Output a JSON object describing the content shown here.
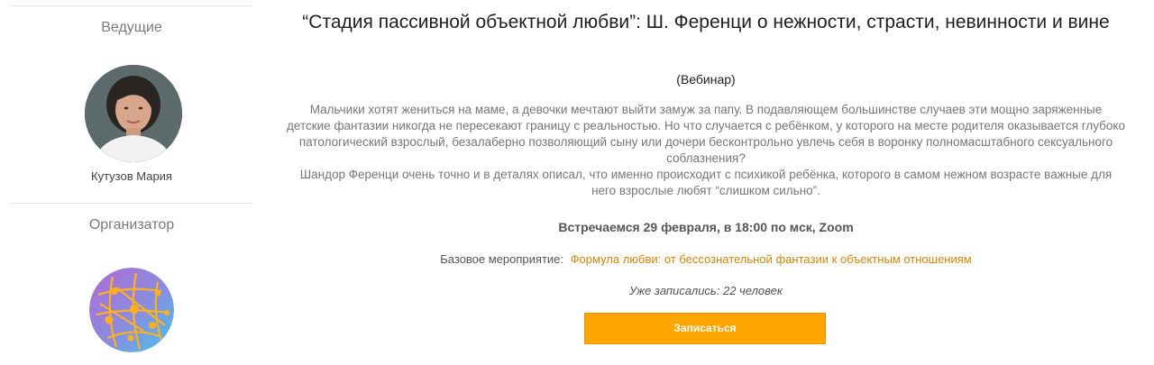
{
  "sidebar": {
    "hosts_heading": "Ведущие",
    "host_name": "Кутузов Мария",
    "organizer_heading": "Организатор"
  },
  "event": {
    "title": "“Стадия пассивной объектной любви”: Ш. Ференци о нежности, страсти, невинности и вине",
    "type": "(Вебинар)",
    "description": [
      "Мальчики хотят жениться на маме, а девочки мечтают выйти замуж за папу. В подавляющем большинстве случаев эти мощно заряженные детские фантазии никогда не пересекают границу с реальностью. Но что случается с ребёнком, у которого на месте родителя оказывается глубоко патологический взрослый, безалаберно позволяющий сыну или дочери бесконтрольно увлечь себя в воронку полномасштабного сексуального соблазнения?",
      "Шандор Ференци очень точно и в деталях описал, что именно происходит с психикой ребёнка, которого в самом нежном возрасте важные для него взрослые любят “слишком сильно”."
    ],
    "meeting": "Встречаемся 29 февраля, в 18:00 по мск, Zoom",
    "base_event_label": "Базовое мероприятие:",
    "base_event_link": "Формула любви: от бессознательной фантазии к объектным отношениям",
    "registered": "Уже записались: 22 человек",
    "signup_button": "Записаться"
  },
  "colors": {
    "accent": "#ffa500",
    "link": "#d4860b"
  }
}
